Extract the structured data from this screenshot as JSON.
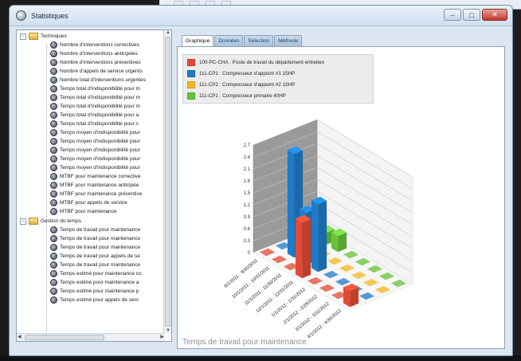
{
  "window": {
    "title": "Statistiques",
    "controls": [
      "minimize",
      "maximize",
      "close"
    ],
    "close_glyph": "✕",
    "min_glyph": "–",
    "max_glyph": "□"
  },
  "tree": {
    "group1": {
      "label": "Techniques",
      "expander": "−",
      "items": [
        "Nombre d'interventions correctives",
        "Nombre d'interventions anticipées",
        "Nombre d'interventions préventives",
        "Nombre d'appels de service urgents",
        "Nombre total d'interventions urgentes",
        "Temps total d'indisponibilité pour m",
        "Temps total d'indisponibilité pour m",
        "Temps total d'indisponibilité pour m",
        "Temps total d'indisponibilité pour a",
        "Temps total d'indisponibilité pour s",
        "Temps moyen d'indisponibilité pour",
        "Temps moyen d'indisponibilité pour",
        "Temps moyen d'indisponibilité pour",
        "Temps moyen d'indisponibilité pour",
        "Temps moyen d'indisponibilité pour",
        "MTBF pour maintenance corrective",
        "MTBF pour maintenance anticipée",
        "MTBF pour maintenance préventive",
        "MTBF pour appels de service",
        "MTBF pour maintenance"
      ]
    },
    "group2": {
      "label": "Gestion du temps",
      "expander": "−",
      "items": [
        "Temps de travail pour maintenance",
        "Temps de travail pour maintenance",
        "Temps de travail pour maintenance",
        "Temps de travail pour appels de se",
        "Temps de travail pour maintenance",
        "Temps estimé pour maintenance co",
        "Temps estimé pour maintenance a",
        "Temps estimé pour maintenance p",
        "Temps estimé pour appels de serv"
      ]
    }
  },
  "tabs": [
    "Graphique",
    "Données",
    "Sélection",
    "Méthode"
  ],
  "active_tab": "Graphique",
  "legend": [
    {
      "label": "100-PC-CHA : Poste de travail du département entretien",
      "color": "#e24a33"
    },
    {
      "label": "111-CP1 : Compresseur d'appoint #1 15HP",
      "color": "#1f7bc8"
    },
    {
      "label": "111-CP2 : Compresseur d'appoint #2 15HP",
      "color": "#f2b81f"
    },
    {
      "label": "111-CP1 : Compresseur primaire 40HP",
      "color": "#66c23a"
    }
  ],
  "chart_data": {
    "type": "bar",
    "subtype": "3d-column",
    "title": "Temps de travail pour maintenance",
    "ylim": [
      0,
      2.7
    ],
    "yticks": [
      "2.7",
      "2.4",
      "2.1",
      "1.8",
      "1.5",
      "1.2",
      "0.9",
      "0.6",
      "0.3",
      "0"
    ],
    "categories": [
      "9/1/2011 - 9/30/2011",
      "10/1/2011 - 10/31/2011",
      "11/1/2011 - 11/30/2011",
      "12/1/2011 - 12/31/2011",
      "1/1/2012 - 1/31/2012",
      "2/1/2012 - 2/29/2012",
      "3/1/2012 - 3/31/2012",
      "4/1/2012 - 4/30/2012"
    ],
    "series": [
      {
        "name": "100-PC-CHA : Poste de travail du département entretien",
        "values": [
          0,
          0,
          0,
          1.4,
          0,
          0,
          0,
          0.4
        ]
      },
      {
        "name": "111-CP1 : Compresseur d'appoint #1 15HP",
        "values": [
          0,
          2.6,
          1.3,
          1.7,
          0,
          0,
          0,
          0
        ]
      },
      {
        "name": "111-CP2 : Compresseur d'appoint #2 15HP",
        "values": [
          0,
          0,
          0,
          0,
          0,
          0,
          0,
          0
        ]
      },
      {
        "name": "111-CP1 : Compresseur primaire 40HP",
        "values": [
          0,
          0.3,
          0.4,
          0,
          0,
          0,
          0,
          0
        ]
      }
    ]
  }
}
